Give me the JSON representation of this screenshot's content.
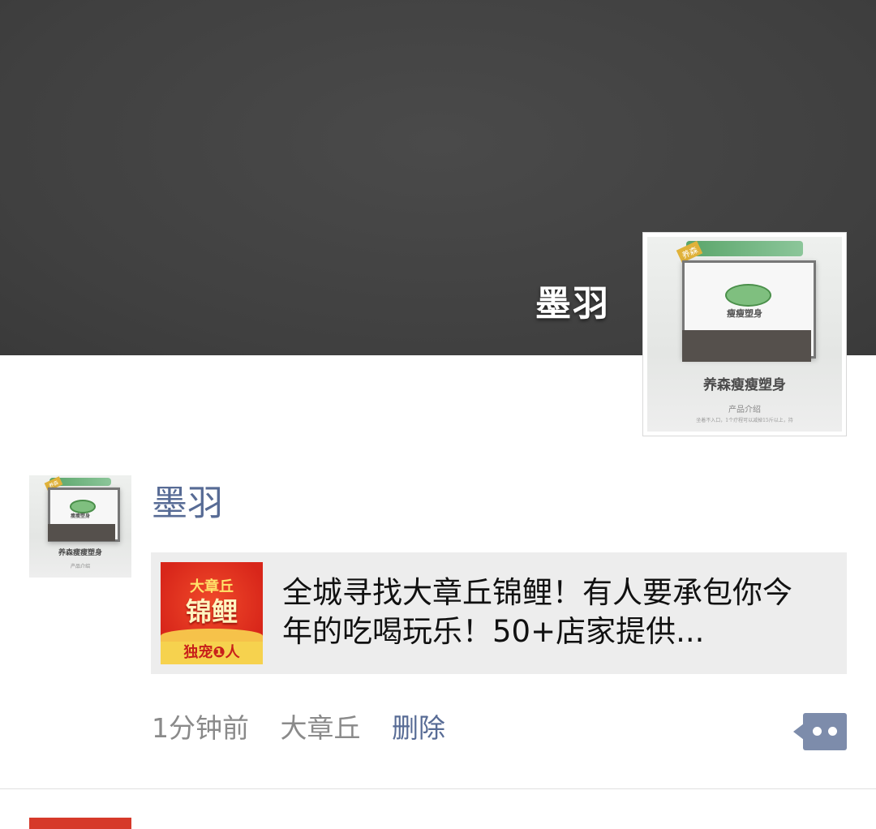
{
  "cover": {
    "user_name": "墨羽"
  },
  "avatar_image": {
    "product_title": "养森瘦瘦塑身",
    "product_label": "瘦瘦塑身",
    "product_subtitle": "产品介绍",
    "product_footnote": "坐着不入口，1个疗程可以减掉15斤以上，持",
    "brand_mark": "养森"
  },
  "post": {
    "author": "墨羽",
    "link": {
      "title": "全城寻找大章丘锦鲤！有人要承包你今年的吃喝玩乐！50+店家提供...",
      "thumb_top": "大章丘",
      "thumb_main": "锦鲤",
      "thumb_bottom": "独宠❶人"
    },
    "time": "1分钟前",
    "location": "大章丘",
    "delete_label": "删除"
  },
  "colors": {
    "link_blue": "#576b95",
    "meta_gray": "#8a8a8a",
    "cover_bg": "#444444",
    "card_bg": "#ededed",
    "more_button": "#7d8cab"
  },
  "icons": {
    "more": "more-comment-icon"
  }
}
